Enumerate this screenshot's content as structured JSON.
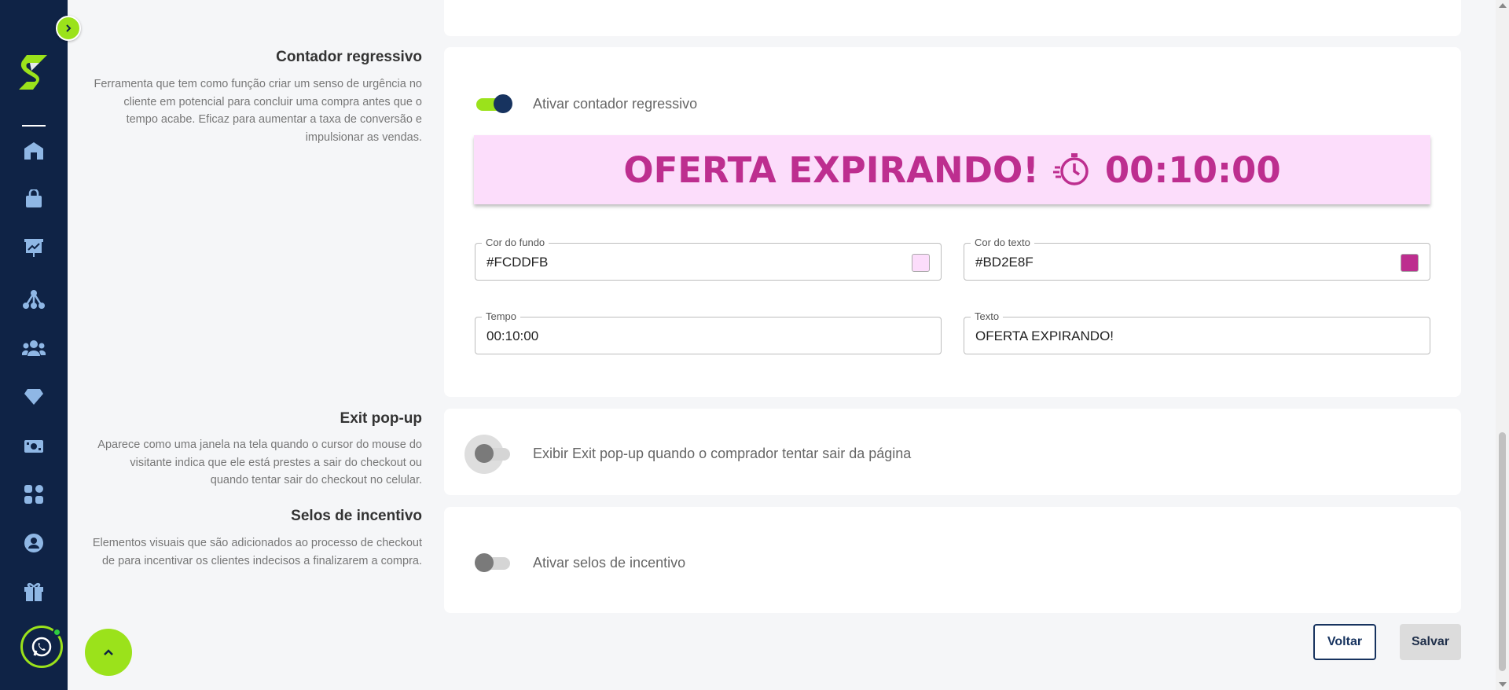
{
  "sidebar": {
    "nav_icons": [
      "home-icon",
      "shopping-bag-icon",
      "presentation-chart-icon",
      "network-icon",
      "users-icon",
      "diamond-icon",
      "money-icon",
      "apps-icon",
      "user-circle-icon",
      "gift-icon"
    ]
  },
  "countdown": {
    "title": "Contador regressivo",
    "description": "Ferramenta que tem como função criar um senso de urgência no cliente em potencial para concluir uma compra antes que o tempo acabe. Eficaz para aumentar a taxa de conversão e impulsionar as vendas.",
    "toggle_label": "Ativar contador regressivo",
    "toggle_on": true,
    "banner_text": "OFERTA EXPIRANDO!",
    "banner_time": "00:10:00",
    "bg_color_label": "Cor do fundo",
    "bg_color_value": "#FCDDFB",
    "text_color_label": "Cor do texto",
    "text_color_value": "#BD2E8F",
    "time_label": "Tempo",
    "time_value": "00:10:00",
    "text_label": "Texto",
    "text_value": "OFERTA EXPIRANDO!"
  },
  "exit_popup": {
    "title": "Exit pop-up",
    "description": "Aparece como uma janela na tela quando o cursor do mouse do visitante indica que ele está prestes a sair do checkout ou quando tentar sair do checkout no celular.",
    "toggle_label": "Exibir Exit pop-up quando o comprador tentar sair da página",
    "toggle_on": false
  },
  "badges": {
    "title": "Selos de incentivo",
    "description": "Elementos visuais que são adicionados ao processo de checkout de para incentivar os clientes indecisos a finalizarem a compra.",
    "toggle_label": "Ativar selos de incentivo",
    "toggle_on": false
  },
  "actions": {
    "back_label": "Voltar",
    "save_label": "Salvar"
  },
  "colors": {
    "sidebar": "#0f2346",
    "accent": "#9be21b",
    "primary": "#17335f"
  }
}
